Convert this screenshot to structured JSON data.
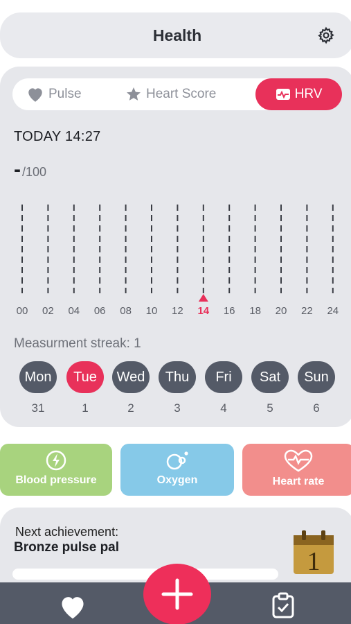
{
  "header": {
    "title": "Health",
    "settings_icon": "gear-icon"
  },
  "tabs": [
    {
      "label": "Pulse",
      "icon": "heart-icon",
      "active": false
    },
    {
      "label": "Heart Score",
      "icon": "star-icon",
      "active": false
    },
    {
      "label": "HRV",
      "icon": "wave-icon",
      "active": true
    }
  ],
  "reading": {
    "timestamp": "TODAY 14:27",
    "value": "-",
    "max": "/100"
  },
  "timeline": {
    "hours": [
      "00",
      "02",
      "04",
      "06",
      "08",
      "10",
      "12",
      "14",
      "16",
      "18",
      "20",
      "22",
      "24"
    ],
    "current_hour": "14"
  },
  "streak": {
    "label": "Measurment streak: 1"
  },
  "days": [
    {
      "name": "Mon",
      "num": "31",
      "active": false
    },
    {
      "name": "Tue",
      "num": "1",
      "active": true
    },
    {
      "name": "Wed",
      "num": "2",
      "active": false
    },
    {
      "name": "Thu",
      "num": "3",
      "active": false
    },
    {
      "name": "Fri",
      "num": "4",
      "active": false
    },
    {
      "name": "Sat",
      "num": "5",
      "active": false
    },
    {
      "name": "Sun",
      "num": "6",
      "active": false
    }
  ],
  "tiles": [
    {
      "label": "Blood pressure",
      "icon": "bolt-icon",
      "color": "#a8d37e"
    },
    {
      "label": "Oxygen",
      "icon": "bubbles-icon",
      "color": "#86c9e8"
    },
    {
      "label": "Heart rate",
      "icon": "heart-pulse-icon",
      "color": "#f28e8c"
    }
  ],
  "achievement": {
    "label": "Next achievement:",
    "name": "Bronze pulse pal",
    "badge": "1",
    "progress": 0
  },
  "nav": {
    "home_icon": "heart-icon",
    "add_icon": "plus-icon",
    "tasks_icon": "clipboard-check-icon"
  },
  "colors": {
    "accent": "#e8315a",
    "dark": "#545a67",
    "card": "#e6e7eb"
  }
}
